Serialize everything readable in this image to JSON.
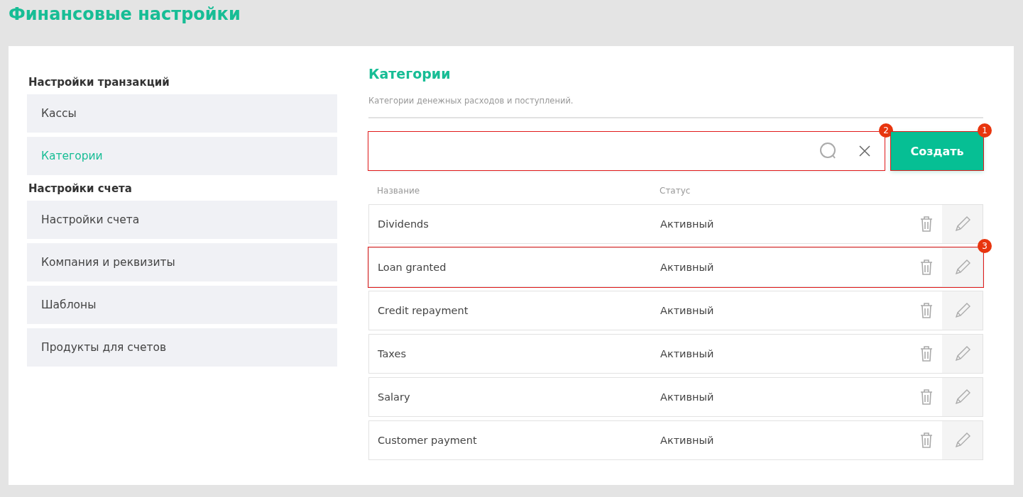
{
  "page": {
    "title": "Финансовые настройки"
  },
  "sidebar": {
    "groups": [
      {
        "heading": "Настройки транзакций",
        "items": [
          {
            "label": "Кассы",
            "selected": false
          },
          {
            "label": "Категории",
            "selected": true
          }
        ]
      },
      {
        "heading": "Настройки счета",
        "items": [
          {
            "label": "Настройки счета",
            "selected": false
          },
          {
            "label": "Компания и реквизиты",
            "selected": false
          },
          {
            "label": "Шаблоны",
            "selected": false
          },
          {
            "label": "Продукты для счетов",
            "selected": false
          }
        ]
      }
    ]
  },
  "content": {
    "title": "Категории",
    "subtitle": "Категории денежных расходов и поступлений.",
    "search": {
      "callout": "2"
    },
    "create_button": {
      "label": "Создать",
      "callout": "1"
    },
    "table": {
      "columns": [
        "Название",
        "Статус"
      ],
      "rows": [
        {
          "name": "Dividends",
          "status": "Активный"
        },
        {
          "name": "Loan granted",
          "status": "Активный",
          "callout": "3"
        },
        {
          "name": "Credit repayment",
          "status": "Активный"
        },
        {
          "name": "Taxes",
          "status": "Активный"
        },
        {
          "name": "Salary",
          "status": "Активный"
        },
        {
          "name": "Customer payment",
          "status": "Активный"
        }
      ]
    }
  }
}
